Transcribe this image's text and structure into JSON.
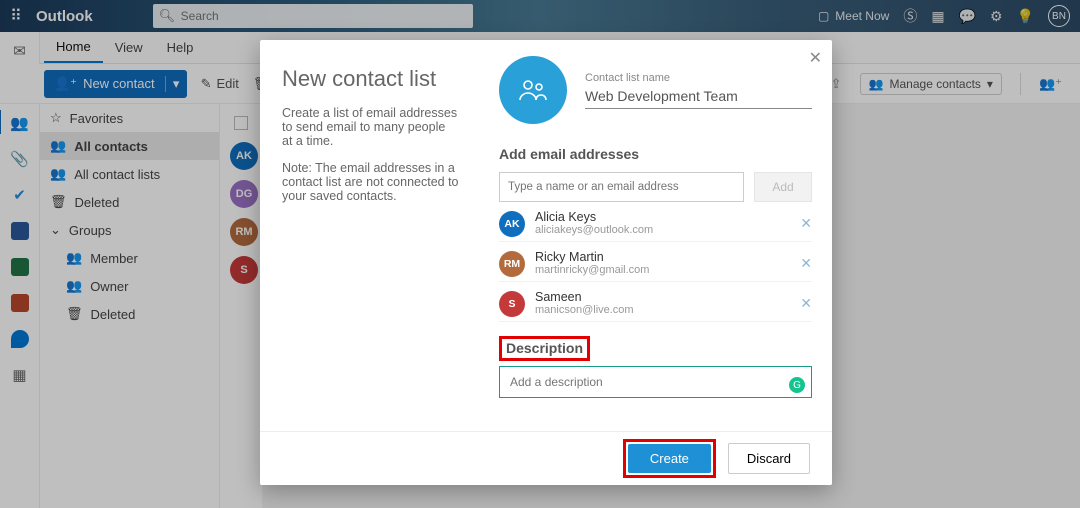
{
  "header": {
    "brand": "Outlook",
    "search_placeholder": "Search",
    "meet_now": "Meet Now",
    "avatar_initials": "BN"
  },
  "tabs": {
    "home": "Home",
    "view": "View",
    "help": "Help"
  },
  "toolbar": {
    "new_contact": "New contact",
    "edit": "Edit",
    "delete_short": "D",
    "manage_contacts": "Manage contacts"
  },
  "sidebar": {
    "favorites": "Favorites",
    "all_contacts": "All contacts",
    "all_contact_lists": "All contact lists",
    "deleted": "Deleted",
    "groups": "Groups",
    "member": "Member",
    "owner": "Owner",
    "deleted2": "Deleted"
  },
  "list_avatars": [
    {
      "initials": "AK",
      "color": "#106ebe"
    },
    {
      "initials": "DG",
      "color": "#9b72c6"
    },
    {
      "initials": "RM",
      "color": "#b36b3e"
    },
    {
      "initials": "S",
      "color": "#c43a3a"
    }
  ],
  "modal": {
    "title": "New contact list",
    "intro1": "Create a list of email addresses to send email to many people at a time.",
    "intro2": "Note: The email addresses in a contact list are not connected to your saved contacts.",
    "name_label": "Contact list name",
    "name_value": "Web Development Team",
    "add_section": "Add email addresses",
    "email_placeholder": "Type a name or an email address",
    "add_btn": "Add",
    "members": [
      {
        "initials": "AK",
        "name": "Alicia Keys",
        "email": "aliciakeys@outlook.com",
        "color": "#106ebe"
      },
      {
        "initials": "RM",
        "name": "Ricky Martin",
        "email": "martinricky@gmail.com",
        "color": "#b36b3e"
      },
      {
        "initials": "S",
        "name": "Sameen",
        "email": "manicson@live.com",
        "color": "#c43a3a"
      }
    ],
    "description_label": "Description",
    "description_placeholder": "Add a description",
    "create": "Create",
    "discard": "Discard"
  }
}
